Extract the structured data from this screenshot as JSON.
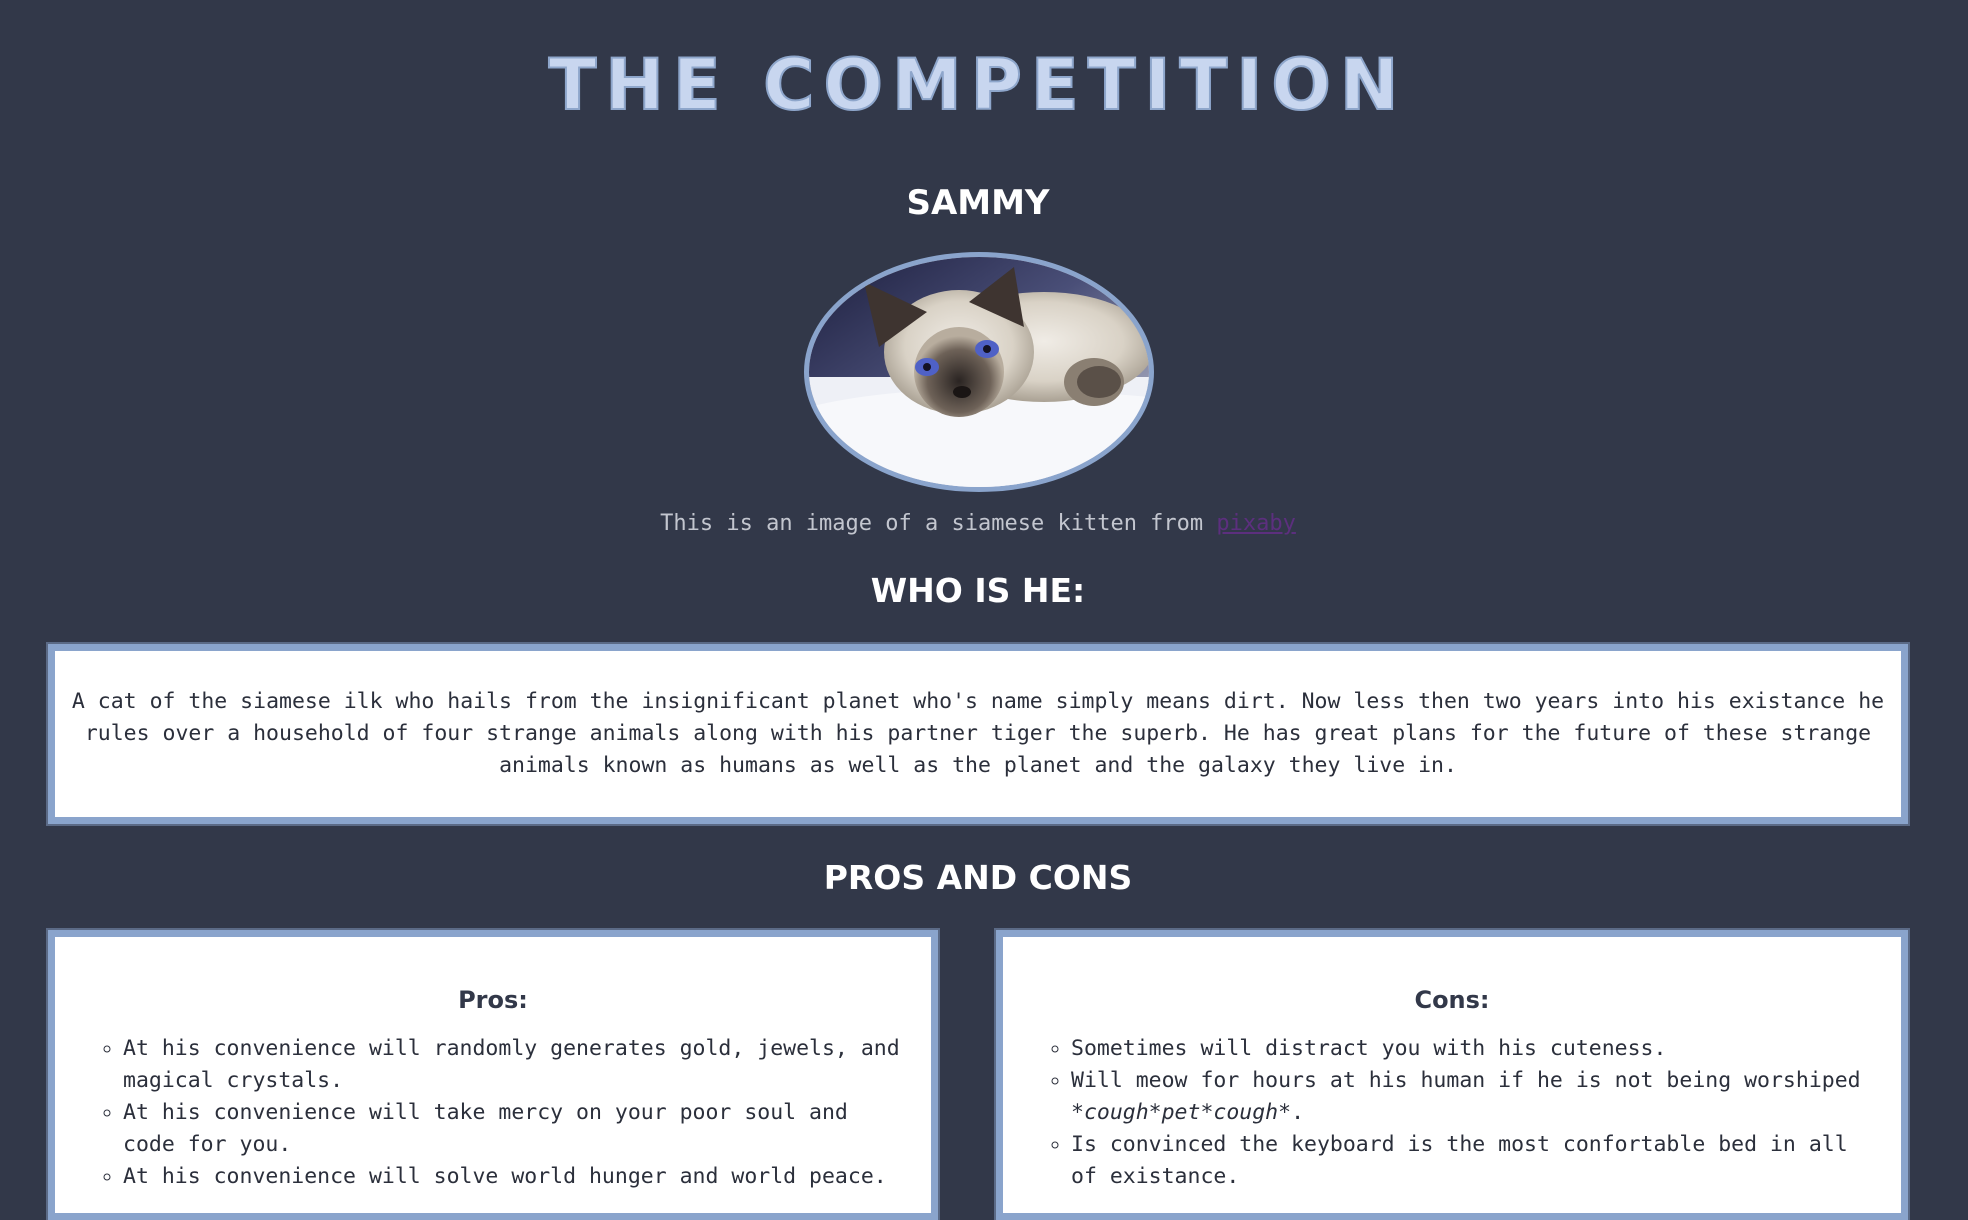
{
  "header": {
    "title": "THE COMPETITION",
    "name": "SAMMY"
  },
  "photo": {
    "subject": "siamese kitten"
  },
  "caption": {
    "text": "This is an image of a siamese kitten from ",
    "link_label": "pixaby"
  },
  "about": {
    "heading": "WHO IS HE:",
    "text": "A cat of the siamese ilk who hails from the insignificant planet who's name simply means dirt. Now less then two years into his existance he rules over a household of four strange animals along with his partner tiger the superb. He has great plans for the future of these strange animals known as humans as well as the planet and the galaxy they live in."
  },
  "pros_cons": {
    "heading": "PROS AND CONS",
    "pros": {
      "title": "Pros:",
      "items": [
        "At his convenience will randomly generates gold, jewels, and magical crystals.",
        "At his convenience will take mercy on your poor soul and code for you.",
        "At his convenience will solve world hunger and world peace."
      ]
    },
    "cons": {
      "title": "Cons:",
      "items": [
        "Sometimes will distract you with his cuteness.",
        "Will meow for hours at his human if he is not being worshiped ",
        "Is convinced the keyboard is the most confortable bed in all of existance."
      ],
      "item2_emphasis": "*cough*pet*cough*",
      "item2_end": "."
    }
  },
  "colors": {
    "background": "#323849",
    "accent": "#8aa4cc",
    "title": "#c8d6ef",
    "link_visited": "#5c2f7e"
  }
}
